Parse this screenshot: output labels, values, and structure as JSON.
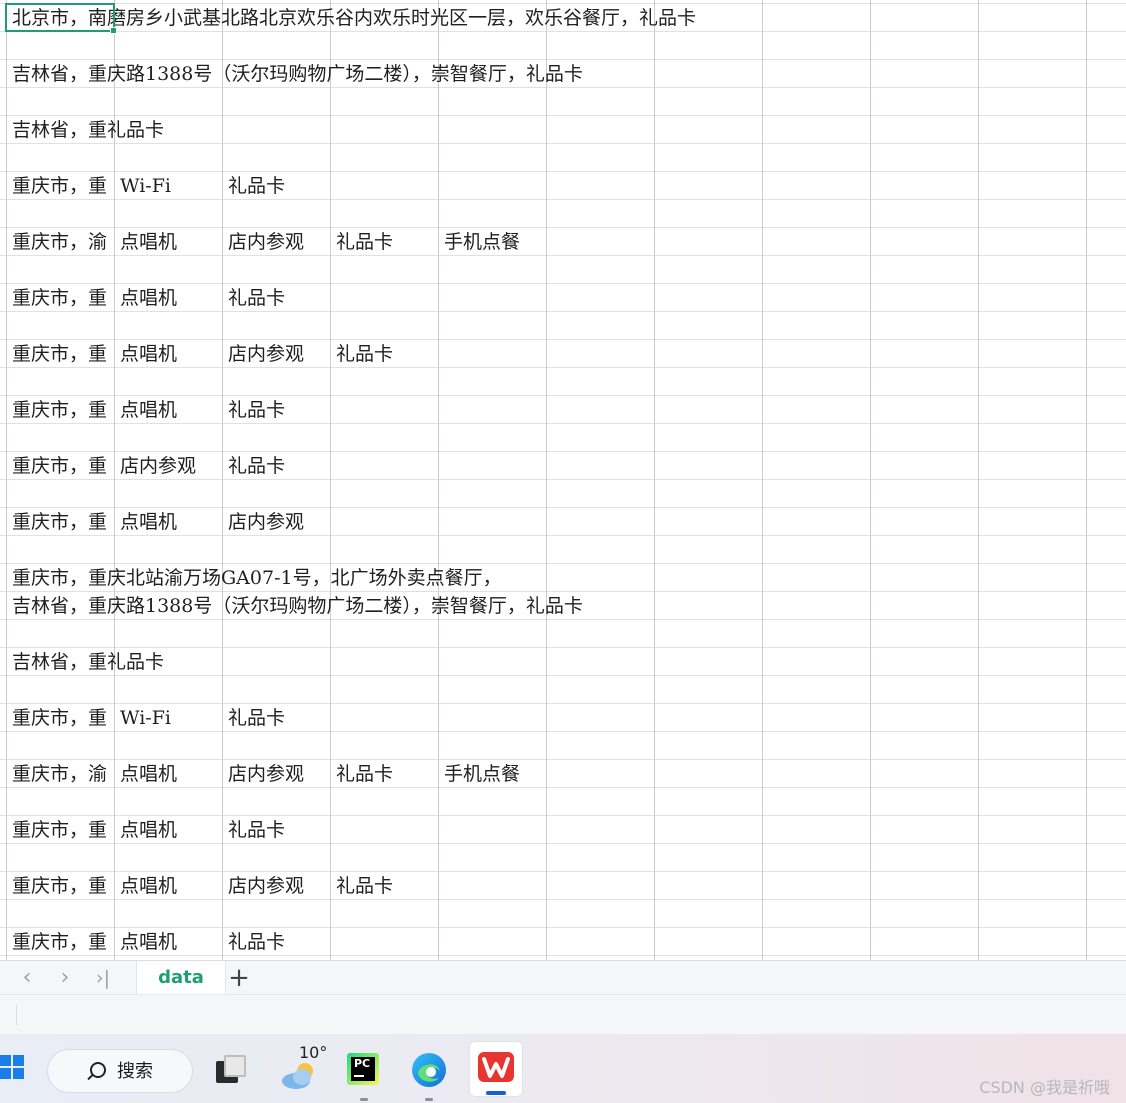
{
  "sheet": {
    "rows": [
      {
        "row": 1,
        "cells": [
          {
            "col": 0,
            "text": "北京市，南磨房乡小武基北路北京欢乐谷内欢乐时光区一层，欢乐谷餐厅，礼品卡"
          }
        ]
      },
      {
        "row": 3,
        "cells": [
          {
            "col": 0,
            "text": "吉林省，重庆路1388号（沃尔玛购物广场二楼），崇智餐厅，礼品卡"
          }
        ]
      },
      {
        "row": 5,
        "cells": [
          {
            "col": 0,
            "text": "吉林省，重礼品卡"
          }
        ]
      },
      {
        "row": 7,
        "cells": [
          {
            "col": 0,
            "text": "重庆市，重",
            "clip": true
          },
          {
            "col": 1,
            "text": "Wi-Fi"
          },
          {
            "col": 2,
            "text": "礼品卡"
          }
        ]
      },
      {
        "row": 9,
        "cells": [
          {
            "col": 0,
            "text": "重庆市，渝",
            "clip": true
          },
          {
            "col": 1,
            "text": "点唱机"
          },
          {
            "col": 2,
            "text": "店内参观"
          },
          {
            "col": 3,
            "text": "礼品卡"
          },
          {
            "col": 4,
            "text": "手机点餐"
          }
        ]
      },
      {
        "row": 11,
        "cells": [
          {
            "col": 0,
            "text": "重庆市，重",
            "clip": true
          },
          {
            "col": 1,
            "text": "点唱机"
          },
          {
            "col": 2,
            "text": "礼品卡"
          }
        ]
      },
      {
        "row": 13,
        "cells": [
          {
            "col": 0,
            "text": "重庆市，重",
            "clip": true
          },
          {
            "col": 1,
            "text": "点唱机"
          },
          {
            "col": 2,
            "text": "店内参观"
          },
          {
            "col": 3,
            "text": "礼品卡"
          }
        ]
      },
      {
        "row": 15,
        "cells": [
          {
            "col": 0,
            "text": "重庆市，重",
            "clip": true
          },
          {
            "col": 1,
            "text": "点唱机"
          },
          {
            "col": 2,
            "text": "礼品卡"
          }
        ]
      },
      {
        "row": 17,
        "cells": [
          {
            "col": 0,
            "text": "重庆市，重",
            "clip": true
          },
          {
            "col": 1,
            "text": "店内参观"
          },
          {
            "col": 2,
            "text": "礼品卡"
          }
        ]
      },
      {
        "row": 19,
        "cells": [
          {
            "col": 0,
            "text": "重庆市，重",
            "clip": true
          },
          {
            "col": 1,
            "text": "点唱机"
          },
          {
            "col": 2,
            "text": "店内参观"
          }
        ]
      },
      {
        "row": 21,
        "cells": [
          {
            "col": 0,
            "text": "重庆市，重庆北站渝万场GA07-1号，北广场外卖点餐厅，"
          }
        ]
      },
      {
        "row": 22,
        "cells": [
          {
            "col": 0,
            "text": "吉林省，重庆路1388号（沃尔玛购物广场二楼），崇智餐厅，礼品卡"
          }
        ]
      },
      {
        "row": 24,
        "cells": [
          {
            "col": 0,
            "text": "吉林省，重礼品卡"
          }
        ]
      },
      {
        "row": 26,
        "cells": [
          {
            "col": 0,
            "text": "重庆市，重",
            "clip": true
          },
          {
            "col": 1,
            "text": "Wi-Fi"
          },
          {
            "col": 2,
            "text": "礼品卡"
          }
        ]
      },
      {
        "row": 28,
        "cells": [
          {
            "col": 0,
            "text": "重庆市，渝",
            "clip": true
          },
          {
            "col": 1,
            "text": "点唱机"
          },
          {
            "col": 2,
            "text": "店内参观"
          },
          {
            "col": 3,
            "text": "礼品卡"
          },
          {
            "col": 4,
            "text": "手机点餐"
          }
        ]
      },
      {
        "row": 30,
        "cells": [
          {
            "col": 0,
            "text": "重庆市，重",
            "clip": true
          },
          {
            "col": 1,
            "text": "点唱机"
          },
          {
            "col": 2,
            "text": "礼品卡"
          }
        ]
      },
      {
        "row": 32,
        "cells": [
          {
            "col": 0,
            "text": "重庆市，重",
            "clip": true
          },
          {
            "col": 1,
            "text": "点唱机"
          },
          {
            "col": 2,
            "text": "店内参观"
          },
          {
            "col": 3,
            "text": "礼品卡"
          }
        ]
      },
      {
        "row": 34,
        "cells": [
          {
            "col": 0,
            "text": "重庆市，重",
            "clip": true
          },
          {
            "col": 1,
            "text": "点唱机"
          },
          {
            "col": 2,
            "text": "礼品卡"
          }
        ]
      }
    ]
  },
  "sheet_tabs": {
    "active": "data",
    "add_symbol": "+",
    "nav_prev": "‹",
    "nav_next": "›",
    "nav_last": "›|"
  },
  "taskbar": {
    "search_label": "搜索",
    "weather_temp": "10°",
    "pycharm_letters": "PC",
    "icons": [
      "windows-start-icon",
      "search-icon",
      "task-view-icon",
      "weather-icon",
      "pycharm-icon",
      "edge-icon",
      "wps-icon"
    ]
  },
  "watermark": "CSDN @我是祈哦",
  "colors": {
    "active_accent": "#1f9e72",
    "windows_blue": "#1a7ee8",
    "wps_red": "#e8352f"
  }
}
